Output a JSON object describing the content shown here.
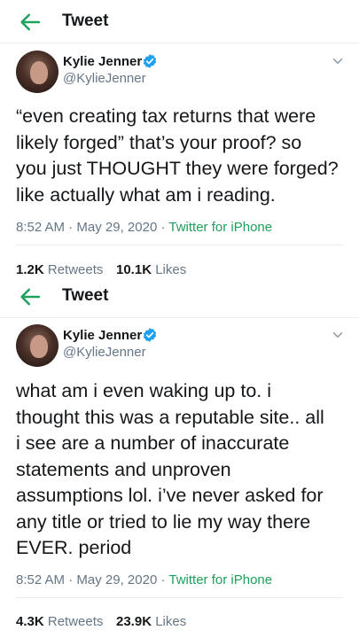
{
  "tweets": [
    {
      "header_title": "Tweet",
      "author": {
        "name": "Kylie Jenner",
        "handle": "@KylieJenner"
      },
      "text": "“even creating tax returns that were\nlikely forged” that’s your proof? so\nyou just THOUGHT they were forged?\nlike actually what am i reading.",
      "time": "8:52 AM",
      "separator": "·",
      "date": "May 29, 2020",
      "source": "Twitter for iPhone",
      "retweets_count": "1.2K",
      "retweets_label": "Retweets",
      "likes_count": "10.1K",
      "likes_label": "Likes"
    },
    {
      "header_title": "Tweet",
      "author": {
        "name": "Kylie Jenner",
        "handle": "@KylieJenner"
      },
      "text": "what am i even waking up to. i\nthought this was a reputable site.. all\ni see are a number of inaccurate\nstatements and unproven\nassumptions lol. i’ve never asked for\nany title or tried to lie my way there\nEVER. period",
      "time": "8:52 AM",
      "separator": "·",
      "date": "May 29, 2020",
      "source": "Twitter for iPhone",
      "retweets_count": "4.3K",
      "retweets_label": "Retweets",
      "likes_count": "23.9K",
      "likes_label": "Likes"
    }
  ],
  "colors": {
    "accent_green": "#1da15c",
    "verified_blue": "#1da1f2",
    "text_primary": "#14171a",
    "text_secondary": "#657786"
  },
  "icons": [
    "back-arrow-icon",
    "verified-badge-icon",
    "chevron-down-icon"
  ]
}
